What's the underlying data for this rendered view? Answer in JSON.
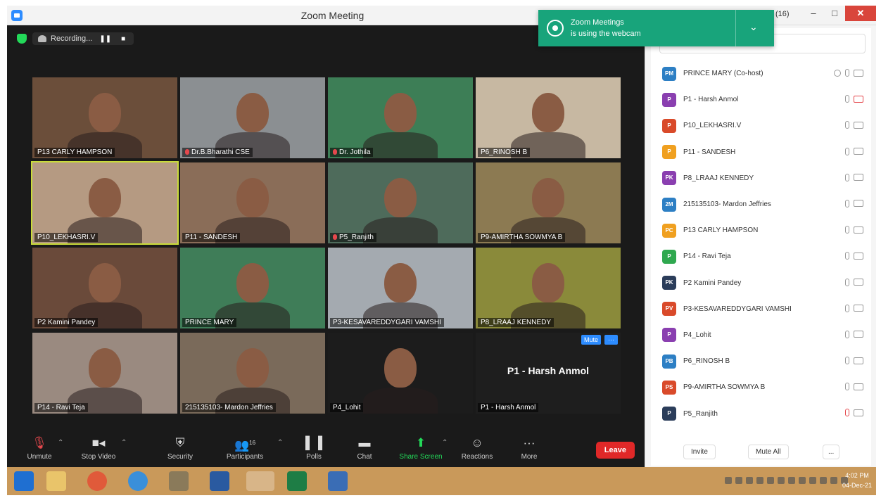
{
  "window": {
    "title": "Zoom Meeting"
  },
  "recording": {
    "label": "Recording...",
    "pause": "❚❚",
    "stop": "■"
  },
  "tiles": [
    {
      "name": "P13 CARLY HAMPSON",
      "bg": "#6b4e3a",
      "muted": false
    },
    {
      "name": "Dr.B.Bharathi CSE",
      "bg": "#8b8f92",
      "muted": true
    },
    {
      "name": "Dr. Jothila",
      "bg": "#3d7e56",
      "muted": true
    },
    {
      "name": "P6_RINOSH B",
      "bg": "#c7b8a2",
      "muted": false
    },
    {
      "name": "P10_LEKHASRI.V",
      "bg": "#b59a82",
      "muted": false
    },
    {
      "name": "P11 - SANDESH",
      "bg": "#8a6d58",
      "muted": false
    },
    {
      "name": "P5_Ranjith",
      "bg": "#4e6b5b",
      "muted": true
    },
    {
      "name": "P9-AMIRTHA SOWMYA B",
      "bg": "#8c7a52",
      "muted": false
    },
    {
      "name": "P2 Kamini Pandey",
      "bg": "#6a4a3a",
      "muted": false
    },
    {
      "name": "PRINCE MARY",
      "bg": "#3f7d58",
      "muted": false
    },
    {
      "name": "P3-KESAVAREDDYGARI VAMSHI",
      "bg": "#a4aab0",
      "muted": false
    },
    {
      "name": "P8_LRAAJ KENNEDY",
      "bg": "#8a8a3a",
      "muted": false
    },
    {
      "name": "P14 - Ravi Teja",
      "bg": "#9a8a80",
      "muted": false
    },
    {
      "name": "215135103- Mardon Jeffries",
      "bg": "#7a6a5a",
      "muted": false
    },
    {
      "name": "P4_Lohit",
      "bg": "#1c1c1c",
      "muted": false
    },
    {
      "name": "P1 - Harsh Anmol",
      "bg": "#1e1e1e",
      "muted": false
    }
  ],
  "active_speaker": {
    "big_name": "P1 - Harsh Anmol",
    "mute_label": "Mute",
    "more_label": "···"
  },
  "toolbar": {
    "unmute": "Unmute",
    "stop_video": "Stop Video",
    "security": "Security",
    "participants": "Participants",
    "participants_count": "16",
    "polls": "Polls",
    "chat": "Chat",
    "share_screen": "Share Screen",
    "reactions": "Reactions",
    "more": "More",
    "leave": "Leave"
  },
  "notification": {
    "line1": "Zoom Meetings",
    "line2": "is using the webcam",
    "chevron": "⌄"
  },
  "participants_panel": {
    "count_label": "(16)",
    "items": [
      {
        "initials": "PM",
        "name": "PRINCE MARY (Co-host)",
        "color": "#2d7fc4",
        "mic_red": false,
        "cam_red": false
      },
      {
        "initials": "P",
        "name": "P1 - Harsh Anmol",
        "color": "#8a3fb0",
        "mic_red": false,
        "cam_red": true
      },
      {
        "initials": "P",
        "name": "P10_LEKHASRI.V",
        "color": "#d94a2a",
        "mic_red": false,
        "cam_red": false
      },
      {
        "initials": "P",
        "name": "P11 - SANDESH",
        "color": "#f0a020",
        "mic_red": false,
        "cam_red": false
      },
      {
        "initials": "PK",
        "name": "P8_LRAAJ KENNEDY",
        "color": "#8a3fb0",
        "mic_red": false,
        "cam_red": false
      },
      {
        "initials": "2M",
        "name": "215135103- Mardon Jeffries",
        "color": "#2d7fc4",
        "mic_red": false,
        "cam_red": false
      },
      {
        "initials": "PC",
        "name": "P13 CARLY HAMPSON",
        "color": "#f0a020",
        "mic_red": false,
        "cam_red": false
      },
      {
        "initials": "P",
        "name": "P14 - Ravi Teja",
        "color": "#2fa84f",
        "mic_red": false,
        "cam_red": false
      },
      {
        "initials": "PK",
        "name": "P2 Kamini Pandey",
        "color": "#2b3d5a",
        "mic_red": false,
        "cam_red": false
      },
      {
        "initials": "PV",
        "name": "P3-KESAVAREDDYGARI VAMSHI",
        "color": "#d94a2a",
        "mic_red": false,
        "cam_red": false
      },
      {
        "initials": "P",
        "name": "P4_Lohit",
        "color": "#8a3fb0",
        "mic_red": false,
        "cam_red": false
      },
      {
        "initials": "PB",
        "name": "P6_RINOSH B",
        "color": "#2d7fc4",
        "mic_red": false,
        "cam_red": false
      },
      {
        "initials": "PS",
        "name": "P9-AMIRTHA SOWMYA B",
        "color": "#d94a2a",
        "mic_red": false,
        "cam_red": false
      },
      {
        "initials": "P",
        "name": "P5_Ranjith",
        "color": "#2b3d5a",
        "mic_red": true,
        "cam_red": false
      }
    ],
    "invite": "Invite",
    "mute_all": "Mute All",
    "more": "..."
  },
  "taskbar": {
    "time": "4:02 PM",
    "date": "04-Dec-21"
  }
}
